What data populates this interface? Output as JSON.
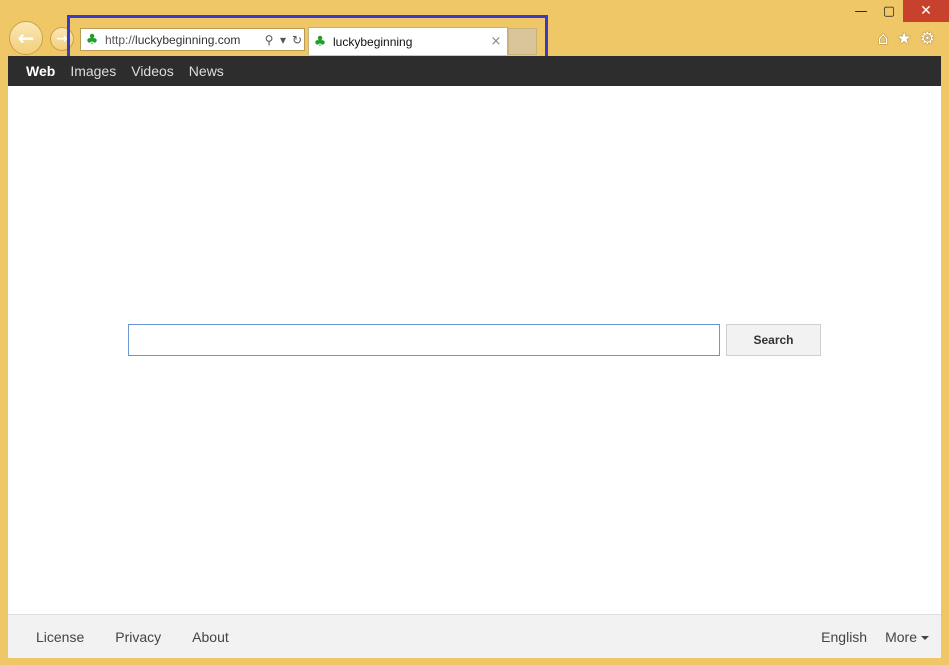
{
  "browser": {
    "window_controls": {
      "minimize": "—",
      "maximize": "▢",
      "close": "✕"
    },
    "back_icon": "←",
    "forward_icon": "→",
    "address": {
      "protocol": "http://",
      "domain": "luckybeginning.com",
      "search_icon": "⚲",
      "dropdown_icon": "▾",
      "refresh_icon": "↻"
    },
    "tab": {
      "title": "luckybeginning",
      "close_icon": "×"
    },
    "toolbar_icons": {
      "home": "⌂",
      "favorites": "★",
      "settings": "⚙"
    },
    "favicon": "♣",
    "highlight_color": "#3a3acb"
  },
  "topnav": {
    "items": [
      {
        "label": "Web",
        "active": true
      },
      {
        "label": "Images",
        "active": false
      },
      {
        "label": "Videos",
        "active": false
      },
      {
        "label": "News",
        "active": false
      }
    ]
  },
  "search": {
    "value": "",
    "placeholder": "",
    "button_label": "Search"
  },
  "footer": {
    "left_links": [
      "License",
      "Privacy",
      "About"
    ],
    "language": "English",
    "more_label": "More"
  }
}
